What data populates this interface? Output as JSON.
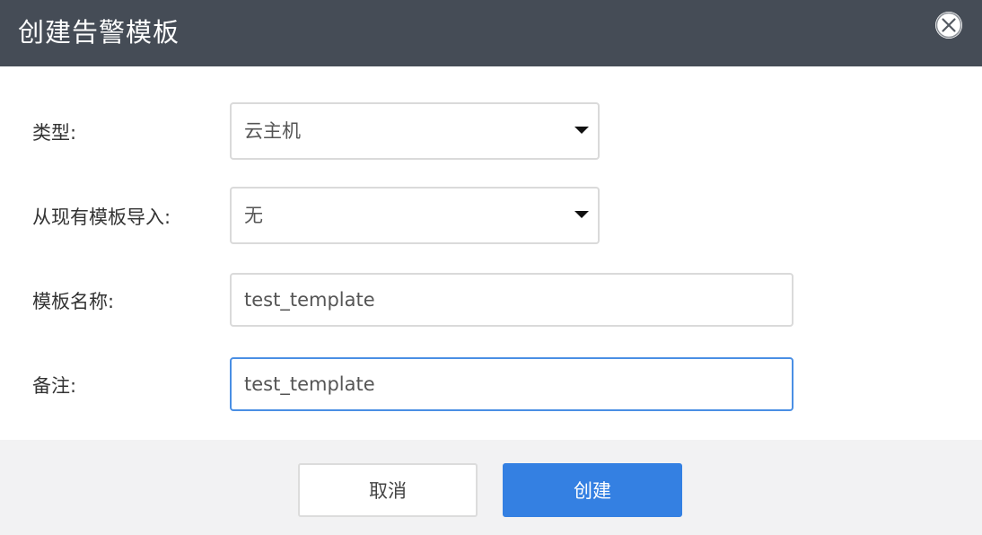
{
  "dialog": {
    "title": "创建告警模板",
    "close_icon": "close-circle-icon"
  },
  "form": {
    "type": {
      "label": "类型:",
      "value": "云主机"
    },
    "import_from": {
      "label": "从现有模板导入:",
      "value": "无"
    },
    "template_name": {
      "label": "模板名称:",
      "value": "test_template"
    },
    "remark": {
      "label": "备注:",
      "value": "test_template"
    }
  },
  "footer": {
    "cancel_label": "取消",
    "create_label": "创建"
  },
  "colors": {
    "titlebar": "#454c56",
    "primary": "#3480e2",
    "focus_border": "#4a8fe4",
    "footer_bg": "#f2f2f3"
  }
}
